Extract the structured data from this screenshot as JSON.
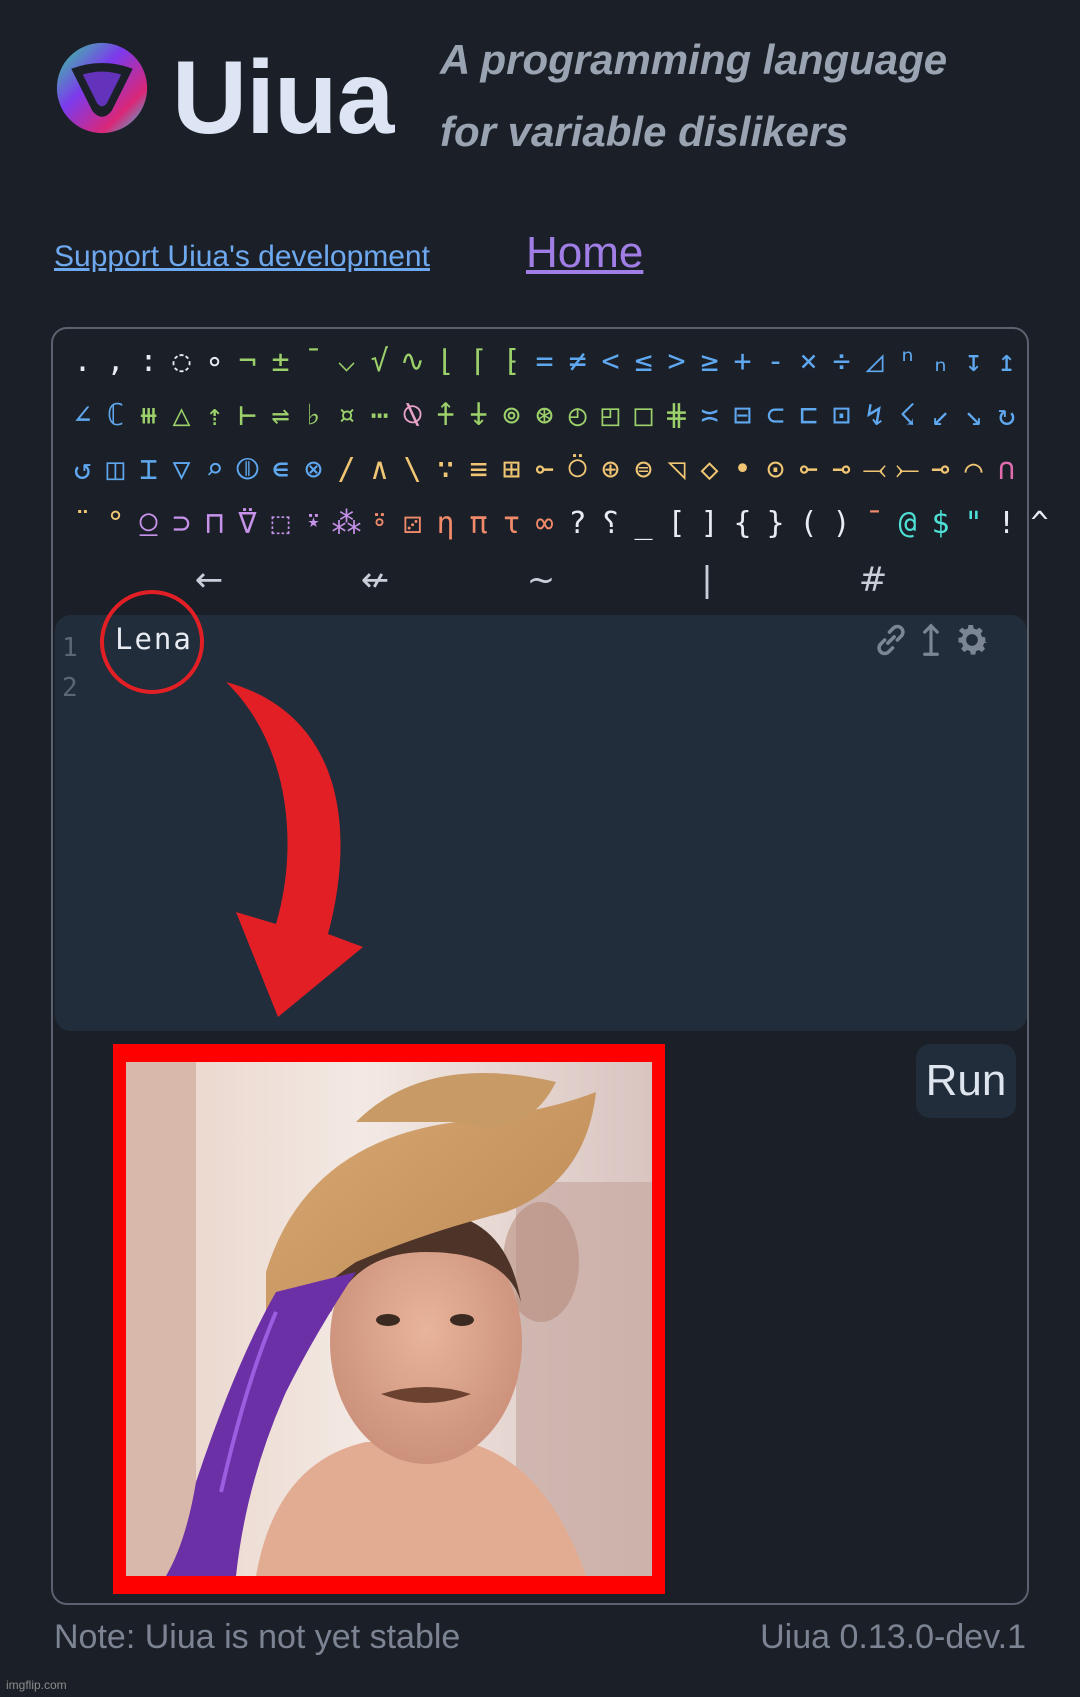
{
  "header": {
    "brand": "Uiua",
    "tagline_line1": "A programming language",
    "tagline_line2": "for variable dislikers"
  },
  "links": {
    "support": "Support Uiua's development",
    "home": "Home"
  },
  "glyph_rows": [
    [
      {
        "g": ".",
        "c": "#e8ecf2"
      },
      {
        "g": ",",
        "c": "#e8ecf2"
      },
      {
        "g": ":",
        "c": "#e8ecf2"
      },
      {
        "g": "◌",
        "c": "#e8ecf2"
      },
      {
        "g": "∘",
        "c": "#e8ecf2"
      },
      {
        "g": "¬",
        "c": "#9bd06a"
      },
      {
        "g": "±",
        "c": "#9bd06a"
      },
      {
        "g": "¯",
        "c": "#9bd06a"
      },
      {
        "g": "⌵",
        "c": "#9bd06a"
      },
      {
        "g": "√",
        "c": "#9bd06a"
      },
      {
        "g": "∿",
        "c": "#9bd06a"
      },
      {
        "g": "⌊",
        "c": "#9bd06a"
      },
      {
        "g": "⌈",
        "c": "#9bd06a"
      },
      {
        "g": "⁅",
        "c": "#9bd06a"
      },
      {
        "g": "=",
        "c": "#5fa8f0"
      },
      {
        "g": "≠",
        "c": "#5fa8f0"
      },
      {
        "g": "<",
        "c": "#5fa8f0"
      },
      {
        "g": "≤",
        "c": "#5fa8f0"
      },
      {
        "g": ">",
        "c": "#5fa8f0"
      },
      {
        "g": "≥",
        "c": "#5fa8f0"
      },
      {
        "g": "+",
        "c": "#5fa8f0"
      },
      {
        "g": "-",
        "c": "#5fa8f0"
      },
      {
        "g": "×",
        "c": "#5fa8f0"
      },
      {
        "g": "÷",
        "c": "#5fa8f0"
      },
      {
        "g": "◿",
        "c": "#5fa8f0"
      },
      {
        "g": "ⁿ",
        "c": "#5fa8f0"
      },
      {
        "g": "ₙ",
        "c": "#5fa8f0"
      },
      {
        "g": "↧",
        "c": "#5fa8f0"
      },
      {
        "g": "↥",
        "c": "#5fa8f0"
      }
    ],
    [
      {
        "g": "∠",
        "c": "#5fa8f0"
      },
      {
        "g": "ℂ",
        "c": "#5fa8f0"
      },
      {
        "g": "⧻",
        "c": "#9bd06a"
      },
      {
        "g": "△",
        "c": "#9bd06a"
      },
      {
        "g": "⇡",
        "c": "#9bd06a"
      },
      {
        "g": "⊢",
        "c": "#9bd06a"
      },
      {
        "g": "⇌",
        "c": "#9bd06a"
      },
      {
        "g": "♭",
        "c": "#9bd06a"
      },
      {
        "g": "¤",
        "c": "#9bd06a"
      },
      {
        "g": "⋯",
        "c": "#9bd06a"
      },
      {
        "g": "⍉",
        "c": "#e8a2c8"
      },
      {
        "g": "⍏",
        "c": "#9bd06a"
      },
      {
        "g": "⍖",
        "c": "#9bd06a"
      },
      {
        "g": "⊚",
        "c": "#9bd06a"
      },
      {
        "g": "⊛",
        "c": "#9bd06a"
      },
      {
        "g": "◴",
        "c": "#9bd06a"
      },
      {
        "g": "◰",
        "c": "#9bd06a"
      },
      {
        "g": "□",
        "c": "#9bd06a"
      },
      {
        "g": "⋕",
        "c": "#9bd06a"
      },
      {
        "g": "≍",
        "c": "#5fa8f0"
      },
      {
        "g": "⊟",
        "c": "#5fa8f0"
      },
      {
        "g": "⊂",
        "c": "#5fa8f0"
      },
      {
        "g": "⊏",
        "c": "#5fa8f0"
      },
      {
        "g": "⊡",
        "c": "#5fa8f0"
      },
      {
        "g": "↯",
        "c": "#5fa8f0"
      },
      {
        "g": "☇",
        "c": "#5fa8f0"
      },
      {
        "g": "↙",
        "c": "#5fa8f0"
      },
      {
        "g": "↘",
        "c": "#5fa8f0"
      },
      {
        "g": "↻",
        "c": "#5fa8f0"
      }
    ],
    [
      {
        "g": "↺",
        "c": "#5fa8f0"
      },
      {
        "g": "◫",
        "c": "#5fa8f0"
      },
      {
        "g": "⌶",
        "c": "#5fa8f0"
      },
      {
        "g": "▽",
        "c": "#5fa8f0"
      },
      {
        "g": "⌕",
        "c": "#5fa8f0"
      },
      {
        "g": "⦷",
        "c": "#5fa8f0"
      },
      {
        "g": "∊",
        "c": "#5fa8f0"
      },
      {
        "g": "⊗",
        "c": "#5fa8f0"
      },
      {
        "g": "/",
        "c": "#f0c674"
      },
      {
        "g": "∧",
        "c": "#f0c674"
      },
      {
        "g": "\\",
        "c": "#f0c674"
      },
      {
        "g": "∵",
        "c": "#f0c674"
      },
      {
        "g": "≡",
        "c": "#f0c674"
      },
      {
        "g": "⊞",
        "c": "#f0c674"
      },
      {
        "g": "⟜",
        "c": "#f0c674"
      },
      {
        "g": "⍥",
        "c": "#f0c674"
      },
      {
        "g": "⊕",
        "c": "#f0c674"
      },
      {
        "g": "⊜",
        "c": "#f0c674"
      },
      {
        "g": "◹",
        "c": "#f0c674"
      },
      {
        "g": "◇",
        "c": "#f0c674"
      },
      {
        "g": "•",
        "c": "#f0c674"
      },
      {
        "g": "⊙",
        "c": "#f0c674"
      },
      {
        "g": "⟜",
        "c": "#f0c674"
      },
      {
        "g": "⊸",
        "c": "#f0c674"
      },
      {
        "g": "⤙",
        "c": "#f0c674"
      },
      {
        "g": "⤚",
        "c": "#f0c674"
      },
      {
        "g": "⊸",
        "c": "#f0c674"
      },
      {
        "g": "⌒",
        "c": "#f0c674"
      },
      {
        "g": "∩",
        "c": "#e06cae"
      }
    ],
    [
      {
        "g": "¨",
        "c": "#f0c674"
      },
      {
        "g": "°",
        "c": "#f0c674"
      },
      {
        "g": "⍜",
        "c": "#c792ea"
      },
      {
        "g": "⊃",
        "c": "#c792ea"
      },
      {
        "g": "⊓",
        "c": "#c792ea"
      },
      {
        "g": "⍢",
        "c": "#c792ea"
      },
      {
        "g": "⬚",
        "c": "#c792ea"
      },
      {
        "g": "⍣",
        "c": "#c792ea"
      },
      {
        "g": "⁂",
        "c": "#c792ea"
      },
      {
        "g": "⍤",
        "c": "#f08a6a"
      },
      {
        "g": "⚂",
        "c": "#f08a6a"
      },
      {
        "g": "η",
        "c": "#f08a6a"
      },
      {
        "g": "π",
        "c": "#f08a6a"
      },
      {
        "g": "τ",
        "c": "#f08a6a"
      },
      {
        "g": "∞",
        "c": "#f08a6a"
      },
      {
        "g": "?",
        "c": "#e8ecf2"
      },
      {
        "g": "⸮",
        "c": "#e8ecf2"
      },
      {
        "g": "_",
        "c": "#e8ecf2"
      },
      {
        "g": "[",
        "c": "#e8ecf2"
      },
      {
        "g": "]",
        "c": "#e8ecf2"
      },
      {
        "g": "{",
        "c": "#e8ecf2"
      },
      {
        "g": "}",
        "c": "#e8ecf2"
      },
      {
        "g": "(",
        "c": "#e8ecf2"
      },
      {
        "g": ")",
        "c": "#e8ecf2"
      },
      {
        "g": "¯",
        "c": "#f08a6a"
      },
      {
        "g": "@",
        "c": "#4ee0d6"
      },
      {
        "g": "$",
        "c": "#4ee0d6"
      },
      {
        "g": "\"",
        "c": "#4ee0d6"
      },
      {
        "g": "!",
        "c": "#e8ecf2"
      },
      {
        "g": "^",
        "c": "#e8ecf2"
      }
    ]
  ],
  "glyph_row5": [
    "←",
    "↚",
    "~",
    "|",
    "#"
  ],
  "editor": {
    "line_numbers": [
      "1",
      "2"
    ],
    "code": "Lena"
  },
  "run_label": "Run",
  "footer": {
    "note": "Note: Uiua is not yet stable",
    "version": "Uiua 0.13.0-dev.1"
  },
  "watermark": "imgflip.com",
  "colors": {
    "background": "#1b2028",
    "editor_bg": "#212d3b",
    "annotation_red": "#e31f26",
    "link_blue": "#6ea8ee",
    "link_purple": "#a07ee6"
  },
  "icons": [
    "uiua-logo",
    "link-icon",
    "arrow-up-down-icon",
    "gear-icon",
    "red-curved-arrow",
    "red-circle-annotation"
  ]
}
